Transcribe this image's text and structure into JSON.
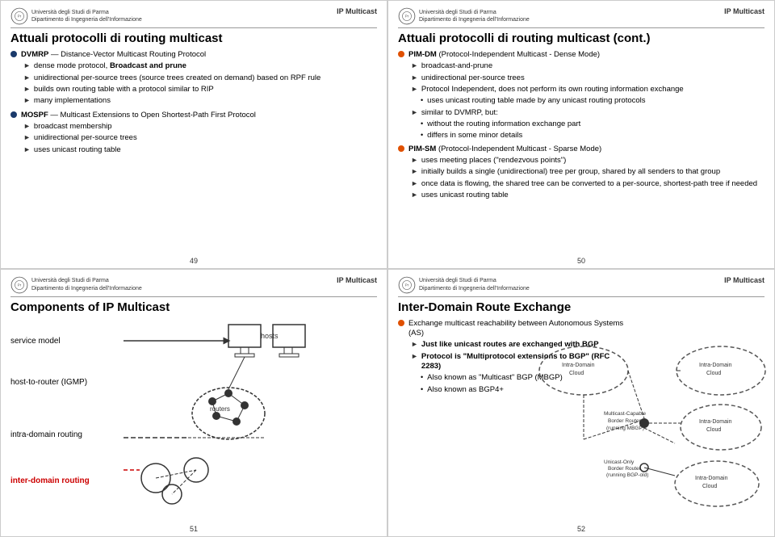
{
  "slides": [
    {
      "id": "slide1",
      "uni_name": "Università degli Studi di Parma\nDipartimento di Ingegneria dell'Informazione",
      "label": "IP Multicast",
      "title": "Attuali protocolli di routing multicast",
      "page": "49",
      "bullets": [
        {
          "type": "circle",
          "text": "DVMRP — Distance-Vector Multicast Routing Protocol",
          "bold": true,
          "children": [
            {
              "type": "arrow",
              "text": "dense mode protocol, Broadcast and prune"
            },
            {
              "type": "arrow",
              "text": "unidirectional per-source trees (source trees created on demand) based on RPF rule"
            },
            {
              "type": "arrow",
              "text": "builds own routing table with a protocol similar to RIP"
            },
            {
              "type": "arrow",
              "text": "many implementations"
            }
          ]
        },
        {
          "type": "circle",
          "text": "MOSPF — Multicast Extensions to Open Shortest-Path First Protocol",
          "bold": true,
          "children": [
            {
              "type": "arrow",
              "text": "broadcast membership"
            },
            {
              "type": "arrow",
              "text": "unidirectional per-source trees"
            },
            {
              "type": "arrow",
              "text": "uses unicast routing table"
            }
          ]
        }
      ]
    },
    {
      "id": "slide2",
      "uni_name": "Università degli Studi di Parma\nDipartimento di Ingegneria dell'Informazione",
      "label": "IP Multicast",
      "title": "Attuali protocolli di routing multicast (cont.)",
      "page": "50",
      "bullets": [
        {
          "type": "circle",
          "text": "PIM-DM (Protocol-Independent Multicast - Dense Mode)",
          "bold": true,
          "children": [
            {
              "type": "arrow",
              "text": "broadcast-and-prune"
            },
            {
              "type": "arrow",
              "text": "unidirectional per-source trees"
            },
            {
              "type": "arrow",
              "text": "Protocol Independent, does not perform its own routing information exchange"
            },
            {
              "type": "sub_dot",
              "text": "uses unicast routing table made by any unicast routing protocols"
            },
            {
              "type": "arrow",
              "text": "similar to DVMRP, but:",
              "bold": true
            },
            {
              "type": "sub_dot",
              "text": "without the routing information exchange part"
            },
            {
              "type": "sub_dot",
              "text": "differs in some minor details"
            }
          ]
        },
        {
          "type": "circle",
          "text": "PIM-SM (Protocol-Independent Multicast - Sparse Mode)",
          "bold": true,
          "children": [
            {
              "type": "arrow",
              "text": "uses meeting places (\"rendezvous points\")"
            },
            {
              "type": "arrow",
              "text": "initially builds a single (unidirectional) tree per group, shared by all senders to that group"
            },
            {
              "type": "arrow",
              "text": "once data is flowing, the shared tree can be converted to a per-source, shortest-path tree if needed"
            },
            {
              "type": "arrow",
              "text": "uses unicast routing table"
            }
          ]
        }
      ]
    },
    {
      "id": "slide3",
      "uni_name": "Università degli Studi di Parma\nDipartimento di Ingegneria dell'Informazione",
      "label": "IP Multicast",
      "title": "Components of IP Multicast",
      "page": "51",
      "components": [
        {
          "label": "service model",
          "color": "black"
        },
        {
          "label": "host-to-router (IGMP)",
          "color": "black"
        },
        {
          "label": "intra-domain routing",
          "color": "black"
        },
        {
          "label": "inter-domain routing",
          "color": "red"
        }
      ]
    },
    {
      "id": "slide4",
      "uni_name": "Università degli Studi di Parma\nDipartimento di Ingegneria dell'Informazione",
      "label": "IP Multicast",
      "title": "Inter-Domain Route Exchange",
      "page": "52",
      "bullets": [
        {
          "type": "circle",
          "text": "Exchange multicast reachability between Autonomous Systems (AS)",
          "children": [
            {
              "type": "arrow_bold",
              "text": "Just like unicast routes are exchanged with BGP"
            },
            {
              "type": "arrow_bold",
              "text": "Protocol is \"Multiprotocol extensions to BGP\" (RFC 2283)"
            },
            {
              "type": "sub_dot",
              "text": "Also known as \"Multicast\" BGP (MBGP)"
            },
            {
              "type": "sub_dot",
              "text": "Also known as BGP4+"
            }
          ]
        }
      ]
    }
  ]
}
